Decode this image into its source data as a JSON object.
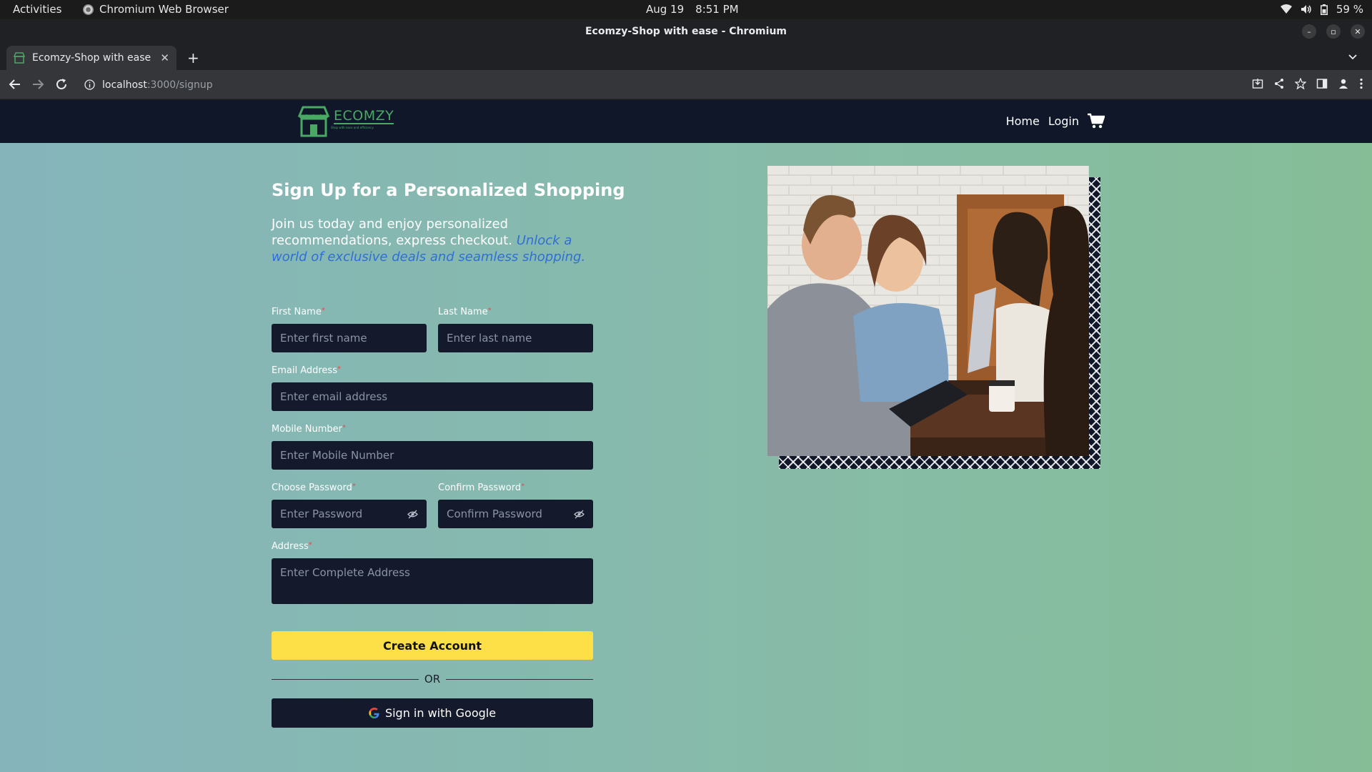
{
  "os": {
    "activities": "Activities",
    "app_name": "Chromium Web Browser",
    "date": "Aug 19",
    "time": "8:51 PM",
    "battery": "59 %"
  },
  "browser": {
    "window_title": "Ecomzy-Shop with ease - Chromium",
    "tab_title": "Ecomzy-Shop with ease",
    "url_host": "localhost",
    "url_path": ":3000/signup"
  },
  "site": {
    "logo_text": "ECOMZY",
    "logo_tagline": "Shop with ease and efficiency",
    "nav": {
      "home": "Home",
      "login": "Login"
    }
  },
  "hero": {
    "title": "Sign Up for a Personalized Shopping",
    "subtitle": "Join us today and enjoy personalized recommendations, express checkout.",
    "accent": "Unlock a world of exclusive deals and seamless shopping."
  },
  "form": {
    "first_name": {
      "label": "First Name",
      "placeholder": "Enter first name"
    },
    "last_name": {
      "label": "Last Name",
      "placeholder": "Enter last name"
    },
    "email": {
      "label": "Email Address",
      "placeholder": "Enter email address"
    },
    "mobile": {
      "label": "Mobile Number",
      "placeholder": "Enter Mobile Number"
    },
    "password": {
      "label": "Choose Password",
      "placeholder": "Enter Password"
    },
    "confirm_password": {
      "label": "Confirm Password",
      "placeholder": "Confirm Password"
    },
    "address": {
      "label": "Address",
      "placeholder": "Enter Complete Address"
    },
    "required_mark": "*",
    "submit": "Create Account",
    "divider": "OR",
    "google": "Sign in with Google"
  },
  "colors": {
    "nav_bg": "#0f1729",
    "brand_green": "#4aa865",
    "accent_blue": "#2f6fd6",
    "button_yellow": "#fde047",
    "required_red": "#e5484d"
  }
}
